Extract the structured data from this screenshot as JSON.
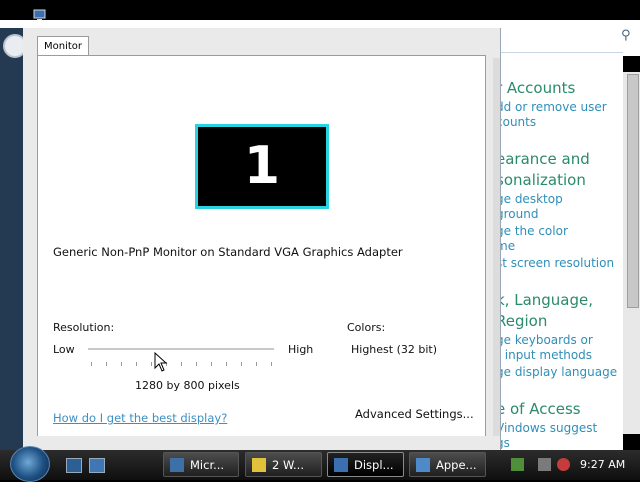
{
  "control_panel": {
    "sections": [
      {
        "title": "r Accounts",
        "links": [
          "dd or remove user",
          "counts"
        ]
      },
      {
        "title_lines": [
          "earance and",
          "sonalization"
        ],
        "links": [
          "ge desktop",
          "ground",
          "ge the color",
          "me",
          "st screen resolution"
        ]
      },
      {
        "title_lines": [
          "k, Language,",
          "Region"
        ],
        "links": [
          "ge keyboards or",
          "r input methods",
          "ge display language"
        ]
      },
      {
        "title": "e of Access",
        "links": [
          "Vindows suggest",
          "gs"
        ]
      }
    ]
  },
  "dialog": {
    "tab_label": "Monitor",
    "monitor_number": "1",
    "monitor_description": "Generic Non-PnP Monitor on Standard VGA Graphics Adapter",
    "resolution": {
      "label": "Resolution:",
      "low_label": "Low",
      "high_label": "High",
      "value_text": "1280 by 800 pixels"
    },
    "colors": {
      "label": "Colors:",
      "value": "Highest (32 bit)"
    },
    "help_link": "How do I get the best display?",
    "advanced_button": "Advanced Settings..."
  },
  "taskbar": {
    "buttons": [
      {
        "label": "Micr..."
      },
      {
        "label": "2 W..."
      },
      {
        "label": "Displ..."
      },
      {
        "label": "Appe..."
      }
    ],
    "clock": "9:27 AM"
  },
  "colors": {
    "monitor_border": "#29d2e0",
    "link": "#3b8fc4",
    "category_green": "#2a8a6b"
  }
}
